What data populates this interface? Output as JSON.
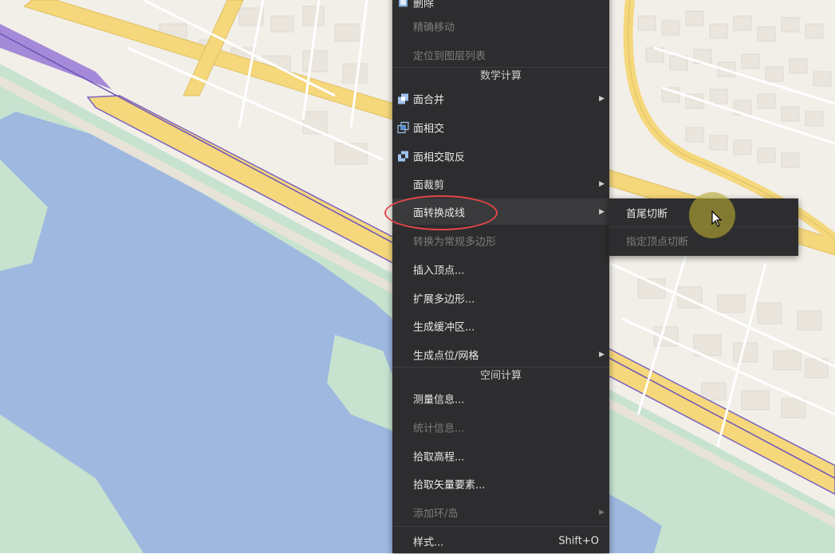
{
  "colors": {
    "water": "#9eb8e0",
    "park": "#c7e3cf",
    "land": "#f2efe9",
    "road_major": "#f5d77c",
    "road_highway": "#a48ad8",
    "menu_bg": "#2d2d2f",
    "highlight_ring": "#e54646"
  },
  "context_menu": {
    "items_top": [
      {
        "label": "删除",
        "enabled": true,
        "icon": "delete-icon"
      },
      {
        "label": "精确移动",
        "enabled": false
      },
      {
        "label": "定位到图层列表",
        "enabled": false
      }
    ],
    "section_math": "数学计算",
    "items_math": [
      {
        "label": "面合并",
        "enabled": true,
        "submenu": true,
        "icon": "polygon-merge-icon"
      },
      {
        "label": "面相交",
        "enabled": true,
        "submenu": false,
        "icon": "polygon-intersect-icon"
      },
      {
        "label": "面相交取反",
        "enabled": true,
        "submenu": false,
        "icon": "polygon-xor-icon"
      },
      {
        "label": "面裁剪",
        "enabled": true,
        "submenu": true
      },
      {
        "label": "面转换成线",
        "enabled": true,
        "submenu": true,
        "hovered": true
      },
      {
        "label": "转换为常规多边形",
        "enabled": false,
        "submenu": false
      },
      {
        "label": "插入顶点...",
        "enabled": true,
        "submenu": false
      },
      {
        "label": "扩展多边形...",
        "enabled": true,
        "submenu": false
      },
      {
        "label": "生成缓冲区...",
        "enabled": true,
        "submenu": false
      },
      {
        "label": "生成点位/网格",
        "enabled": true,
        "submenu": true
      }
    ],
    "section_spatial": "空间计算",
    "items_spatial": [
      {
        "label": "测量信息...",
        "enabled": true
      },
      {
        "label": "统计信息...",
        "enabled": false
      },
      {
        "label": "拾取高程...",
        "enabled": true
      },
      {
        "label": "拾取矢量要素...",
        "enabled": true
      },
      {
        "label": "添加环/岛",
        "enabled": false,
        "submenu": true
      }
    ],
    "style_item": {
      "label": "样式...",
      "shortcut": "Shift+O"
    }
  },
  "submenu": {
    "items": [
      {
        "label": "首尾切断",
        "enabled": true
      },
      {
        "label": "指定顶点切断",
        "enabled": false
      }
    ]
  }
}
